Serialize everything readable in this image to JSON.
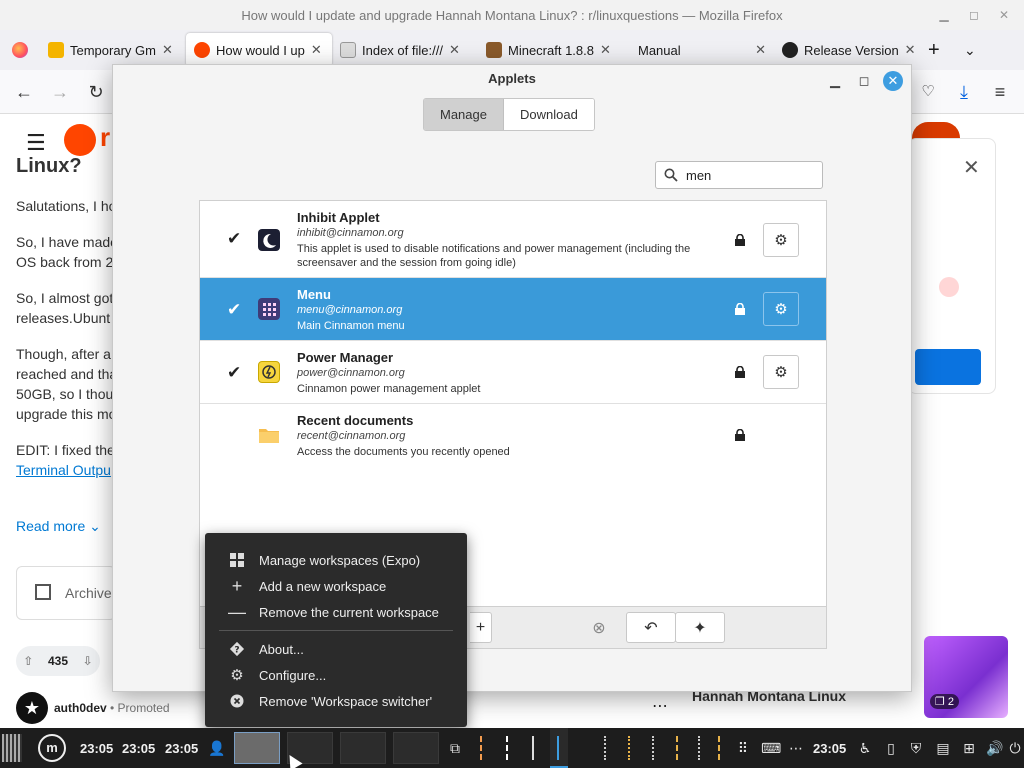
{
  "firefox": {
    "window_title": "How would I update and upgrade Hannah Montana Linux? : r/linuxquestions — Mozilla Firefox",
    "tabs": [
      {
        "label": "Temporary Gm"
      },
      {
        "label": "How would I up"
      },
      {
        "label": "Index of file:///"
      },
      {
        "label": "Minecraft 1.8.8"
      },
      {
        "label": "Manual"
      },
      {
        "label": "Release Version"
      }
    ]
  },
  "page": {
    "brand_letter": "r",
    "heading_fragment": "Linux?",
    "lines": [
      "Salutations, I ho",
      "So, I have made",
      "OS back from 2",
      "So, I almost got",
      "releases.Ubunt",
      "Though, after a",
      "reached and tha",
      "50GB, so I thou",
      "upgrade this mo",
      "EDIT: I fixed the"
    ],
    "link": "Terminal Outpu",
    "read_more": "Read more",
    "archive": "Archive",
    "votes": "435",
    "promoted_user": "auth0dev",
    "promoted_label": "Promoted",
    "sidebar_title": "Hannah Montana Linux",
    "thumb_count": "2"
  },
  "applets": {
    "title": "Applets",
    "tabs": {
      "manage": "Manage",
      "download": "Download"
    },
    "search_value": "men",
    "items": [
      {
        "name": "Inhibit Applet",
        "uuid": "inhibit@cinnamon.org",
        "desc": "This applet is used to disable notifications and power management (including the screensaver and the session from going idle)",
        "checked": true
      },
      {
        "name": "Menu",
        "uuid": "menu@cinnamon.org",
        "desc": "Main Cinnamon menu",
        "checked": true
      },
      {
        "name": "Power Manager",
        "uuid": "power@cinnamon.org",
        "desc": "Cinnamon power management applet",
        "checked": true
      },
      {
        "name": "Recent documents",
        "uuid": "recent@cinnamon.org",
        "desc": "Access the documents you recently opened",
        "checked": false
      }
    ]
  },
  "context_menu": {
    "items": [
      {
        "label": "Manage workspaces (Expo)",
        "icon": "grid-icon"
      },
      {
        "label": "Add a new workspace",
        "icon": "plus-icon"
      },
      {
        "label": "Remove the current workspace",
        "icon": "minus-icon"
      },
      {
        "label": "About...",
        "icon": "help-icon"
      },
      {
        "label": "Configure...",
        "icon": "gear-icon"
      },
      {
        "label": "Remove 'Workspace switcher'",
        "icon": "remove-icon"
      }
    ]
  },
  "taskbar": {
    "clocks": [
      "23:05",
      "23:05",
      "23:05"
    ],
    "tray_clock": "23:05"
  },
  "colors": {
    "selection": "#3a9ad9",
    "taskbar_bg": "#1d1d1d",
    "menu_bg": "#2b2b2b",
    "reddit_orange": "#ff4500"
  }
}
